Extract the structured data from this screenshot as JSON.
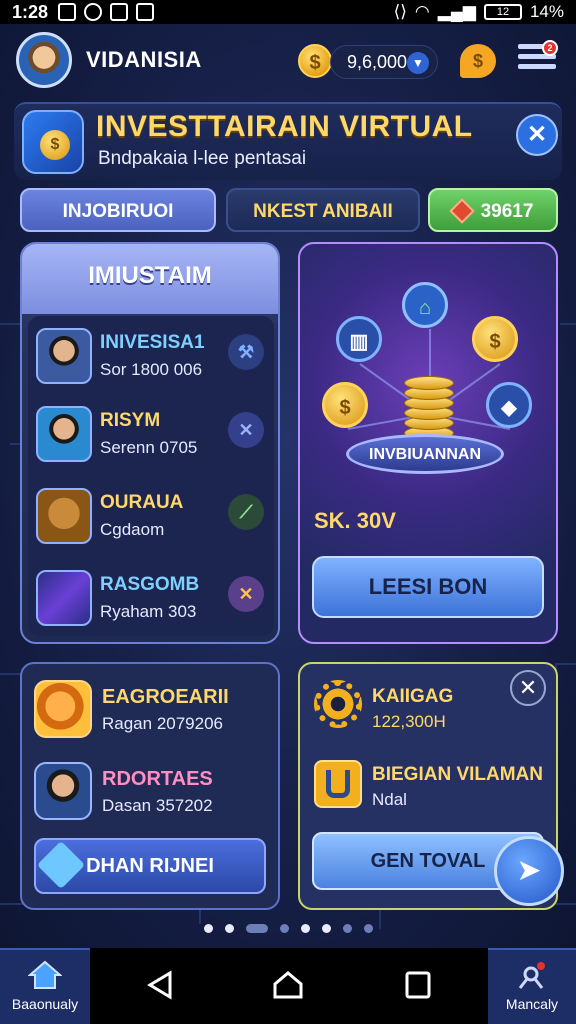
{
  "status_bar": {
    "time": "1:28",
    "battery_label": "12",
    "battery": "14%"
  },
  "header": {
    "username": "VIDANISIA",
    "coin_symbol": "$",
    "balance": "9,6,000",
    "chat_symbol": "$",
    "notif_count": "2"
  },
  "title": {
    "heading": "INVESTTAIRAIN VIRTUAL",
    "subheading": "Bndpakaia l-lee pentasai",
    "close_symbol": "✕"
  },
  "tabs": [
    {
      "label": "INJOBIRUOI"
    },
    {
      "label": "NKEST ANIBAII"
    },
    {
      "label": "39617"
    }
  ],
  "left_panel": {
    "heading": "IMIUSTAIM",
    "items": [
      {
        "name": "INIVESISA1",
        "value": "Sor 1800 006",
        "action": "⚒"
      },
      {
        "name": "RISYM",
        "value": "Serenn 0705",
        "action": "✕"
      },
      {
        "name": "OURAUA",
        "value": "Cgdaom",
        "action": "⟋"
      },
      {
        "name": "RASGOMB",
        "value": "Ryaham 303",
        "action": "✕"
      }
    ]
  },
  "right_panel": {
    "podium_label": "INVBIUANNAN",
    "price": "SK. 30V",
    "buy_label": "LEESI BON"
  },
  "bottom_left": {
    "item1_name": "EAGROEARII",
    "item1_sub": "Ragan 2079206",
    "item2_name": "RDORTAES",
    "item2_sub": "Dasan 357202",
    "button_label": "DHAN RIJNEI"
  },
  "bottom_right": {
    "close_symbol": "✕",
    "item1_name": "KAIIGAG",
    "item1_sub": "122,300H",
    "item2_name": "BIEGIAN VILAMAN",
    "item2_sub": "Ndal",
    "button_label": "GEN TOVAL"
  },
  "nav": {
    "home_label": "Baaonualy",
    "right_label": "Mancaly"
  },
  "colors": {
    "accent": "#ffd86b",
    "primary": "#2c6fe0",
    "bg": "#17214a"
  }
}
